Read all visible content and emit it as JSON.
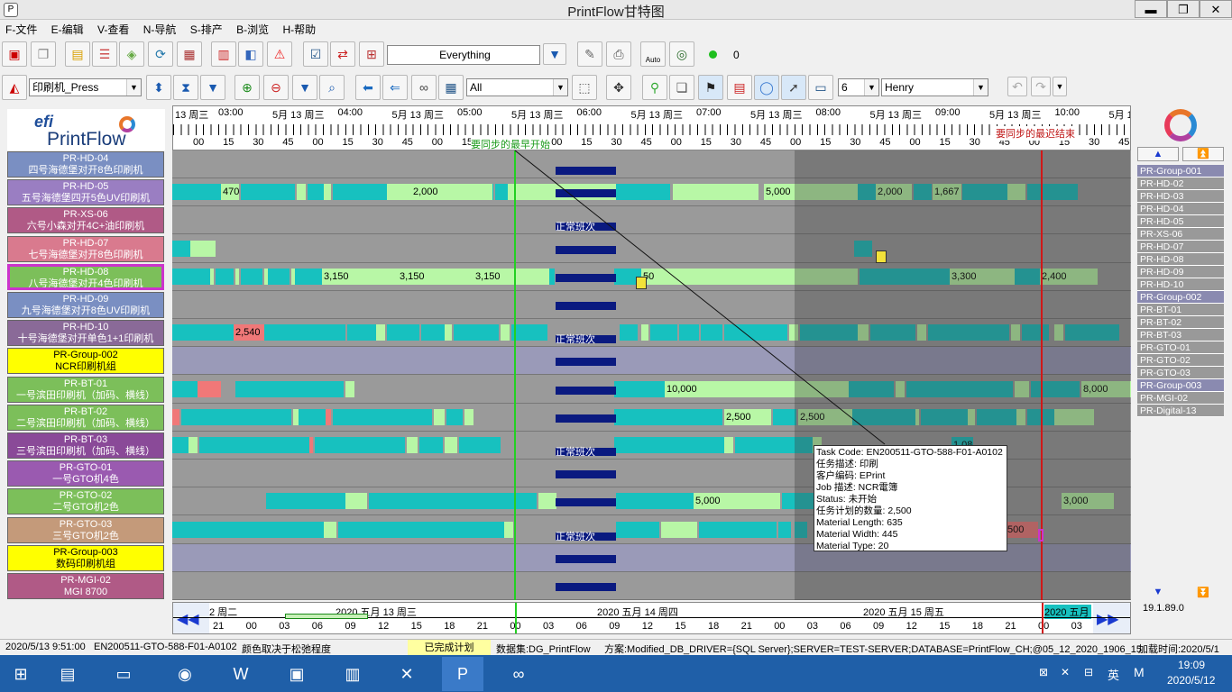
{
  "window": {
    "title": "PrintFlow甘特图",
    "min": "▬",
    "max": "❐",
    "close": "✕",
    "app_icon": "P"
  },
  "menu": [
    "F-文件",
    "E-编辑",
    "V-查看",
    "N-导航",
    "S-排产",
    "B-浏览",
    "H-帮助"
  ],
  "toolbar1": {
    "filter_value": "Everything",
    "counter": "0",
    "auto_label": "Auto"
  },
  "toolbar2": {
    "press_select": "印刷机_Press",
    "all_select": "All",
    "num_select": "6",
    "user_select": "Henry"
  },
  "logo": {
    "efi": "efi",
    "printflow": "PrintFlow"
  },
  "resources": [
    {
      "code": "PR-HD-04",
      "name": "四号海德堡对开8色印刷机",
      "color": "#7a8fc2"
    },
    {
      "code": "PR-HD-05",
      "name": "五号海德堡四开5色UV印刷机",
      "color": "#9a7ec2"
    },
    {
      "code": "PR-XS-06",
      "name": "六号小森对开4C+油印刷机",
      "color": "#b05a86"
    },
    {
      "code": "PR-HD-07",
      "name": "七号海德堡对开8色印刷机",
      "color": "#d97a8e"
    },
    {
      "code": "PR-HD-08",
      "name": "八号海德堡对开4色印刷机",
      "color": "#7cbf5a",
      "selected": true
    },
    {
      "code": "PR-HD-09",
      "name": "九号海德堡对开8色UV印刷机",
      "color": "#7a8fc2"
    },
    {
      "code": "PR-HD-10",
      "name": "十号海德堡对开单色1+1印刷机",
      "color": "#8a6a98"
    },
    {
      "code": "PR-Group-002",
      "name": "NCR印刷机组",
      "color": "#ffff00"
    },
    {
      "code": "PR-BT-01",
      "name": "一号滨田印刷机（加码、横线）",
      "color": "#7cbf5a"
    },
    {
      "code": "PR-BT-02",
      "name": "二号滨田印刷机（加码、横线）",
      "color": "#7cbf5a"
    },
    {
      "code": "PR-BT-03",
      "name": "三号滨田印刷机（加码、横线）",
      "color": "#8a4a98"
    },
    {
      "code": "PR-GTO-01",
      "name": "一号GTO机4色",
      "color": "#9a5ab0"
    },
    {
      "code": "PR-GTO-02",
      "name": "二号GTO机2色",
      "color": "#7cbf5a"
    },
    {
      "code": "PR-GTO-03",
      "name": "三号GTO机2色",
      "color": "#c49a7a"
    },
    {
      "code": "PR-Group-003",
      "name": "数码印刷机组",
      "color": "#ffff00"
    },
    {
      "code": "PR-MGI-02",
      "name": "MGI 8700",
      "color": "#b05a86"
    }
  ],
  "timeline": {
    "dates": [
      "5月 13 周三",
      "5月 13 周三",
      "5月 13 周三",
      "5月 13 周三",
      "5月 13 周三",
      "5月 13 周三",
      "5月 13 周三",
      "5月 13 周三",
      "5月 13 周三"
    ],
    "hours": [
      "03:00",
      "04:00",
      "05:00",
      "06:00",
      "07:00",
      "08:00",
      "09:00",
      "10:00"
    ],
    "first_label": "13 周三",
    "minutes": [
      "00",
      "15",
      "30",
      "45"
    ],
    "earliest": "要同步的最早开始",
    "latest": "要同步的最迟结束"
  },
  "gantt": {
    "shift_label": "正常班次"
  },
  "bar_labels": {
    "r1a": "470",
    "r1b": "2,000",
    "r1c": "5,000",
    "r1d": "2,000",
    "r1e": "1,667",
    "r4a": "3,150",
    "r4b": "3,150",
    "r4c": "3,150",
    "r4d": "50",
    "r4e": "3,300",
    "r4f": "2,400",
    "r6a": "2,540",
    "r8a": "10,000",
    "r8b": "8,000",
    "r9a": "2,500",
    "r9b": "2,500",
    "r10a": "1,080",
    "r12a": "5,000",
    "r12b": "3,000",
    "r13a": "500"
  },
  "tooltip": [
    "Task Code: EN200511-GTO-588-F01-A0102",
    "任务描述: 印刷",
    "客户编码: EPrint",
    "Job 描述: NCR電簿",
    "Status: 未开始",
    "任务计划的数量: 2,500",
    "Material Length: 635",
    "Material Width: 445",
    "Material Type: 20"
  ],
  "bottom_axis": {
    "days": [
      "2 周二",
      "2020 五月 13 周三",
      "2020 五月 14 周四",
      "2020 五月 15 周五",
      "2020 五月"
    ],
    "hours": [
      "21",
      "00",
      "03",
      "06",
      "09",
      "12",
      "15",
      "18",
      "21",
      "00",
      "03",
      "06",
      "09",
      "12",
      "15",
      "18",
      "21",
      "00",
      "03",
      "06",
      "09",
      "12",
      "15",
      "18",
      "21",
      "00",
      "03"
    ]
  },
  "right_panel": {
    "items": [
      "PR-Group-001",
      "PR-HD-02",
      "PR-HD-03",
      "PR-HD-04",
      "PR-HD-05",
      "PR-XS-06",
      "PR-HD-07",
      "PR-HD-08",
      "PR-HD-09",
      "PR-HD-10",
      "PR-Group-002",
      "PR-BT-01",
      "PR-BT-02",
      "PR-BT-03",
      "PR-GTO-01",
      "PR-GTO-02",
      "PR-GTO-03",
      "PR-Group-003",
      "PR-MGI-02",
      "PR-Digital-13"
    ],
    "version": "19.1.89.0"
  },
  "status": {
    "datetime": "2020/5/13 9:51:00",
    "task": "EN200511-GTO-588-F01-A0102",
    "color_note": "颜色取决于松弛程度",
    "completed": "已完成计划",
    "dataset": "数据集:DG_PrintFlow",
    "scheme": "方案:Modified_DB_DRIVER={SQL Server};SERVER=TEST-SERVER;DATABASE=PrintFlow_CH;@05_12_2020_1906_15",
    "load_time": "加载时间:2020/5/1"
  },
  "taskbar": {
    "time": "19:09",
    "date": "2020/5/12",
    "lang": "英",
    "ime": "M"
  }
}
